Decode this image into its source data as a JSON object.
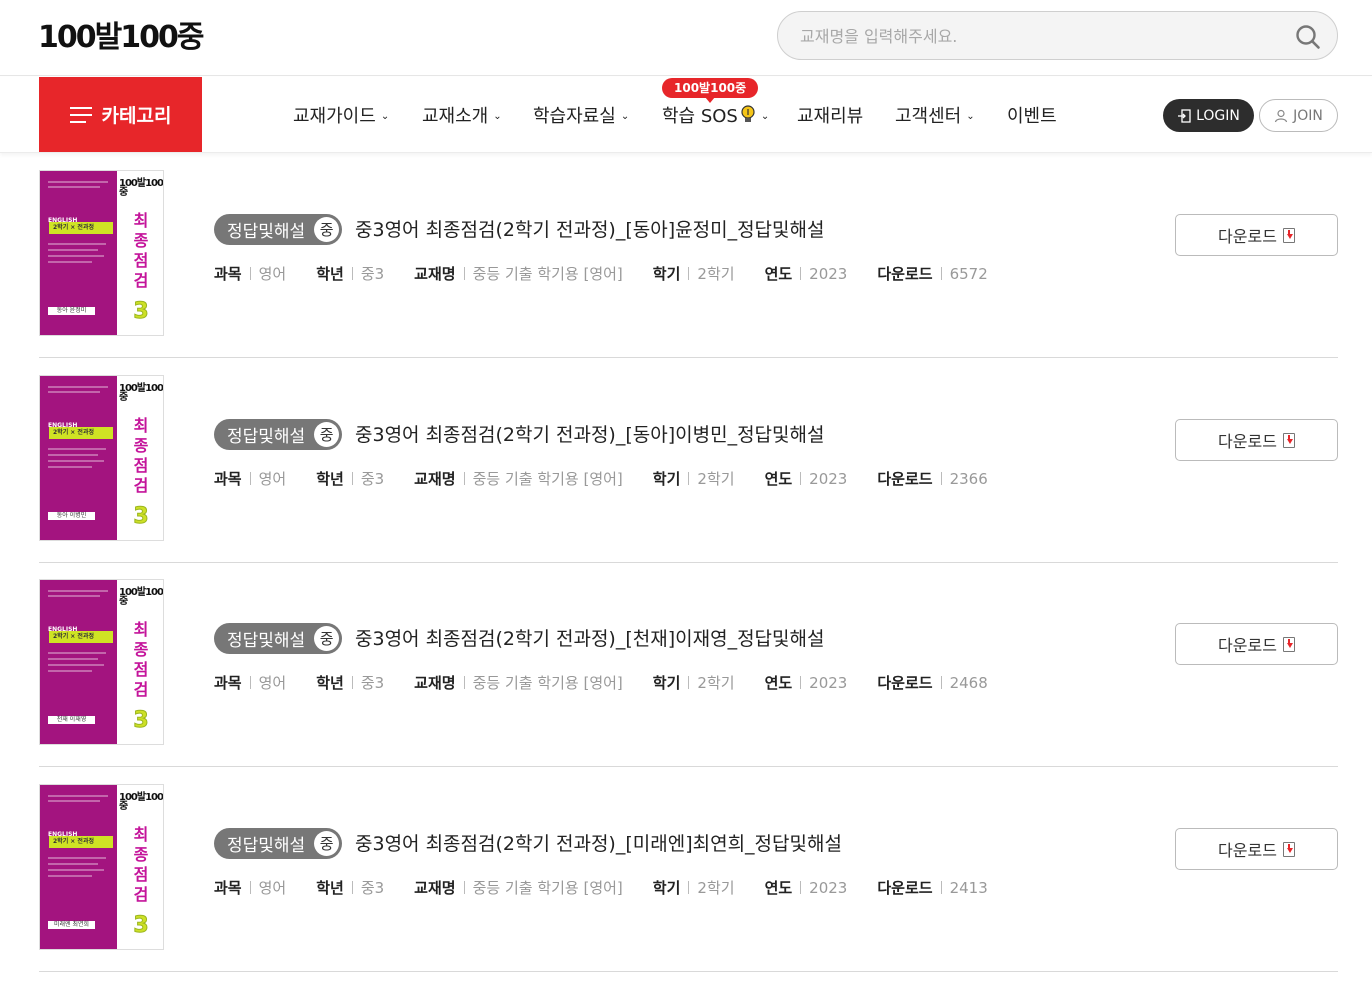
{
  "header": {
    "logo_text": "100발100중",
    "search_placeholder": "교재명을 입력해주세요."
  },
  "nav": {
    "category_label": "카테고리",
    "items": [
      {
        "label": "교재가이드",
        "chevron": "⌄"
      },
      {
        "label": "교재소개",
        "chevron": "⌄"
      },
      {
        "label": "학습자료실",
        "chevron": "⌄"
      },
      {
        "label": "학습 SOS",
        "chevron": "⌄"
      },
      {
        "label": "교재리뷰",
        "chevron": ""
      },
      {
        "label": "고객센터",
        "chevron": "⌄"
      },
      {
        "label": "이벤트",
        "chevron": ""
      }
    ],
    "sos_badge": "100발100중",
    "login_label": "LOGIN",
    "join_label": "JOIN"
  },
  "list": {
    "meta_keys": {
      "subject": "과목",
      "grade": "학년",
      "book": "교재명",
      "semester": "학기",
      "year": "연도",
      "downloads": "다운로드"
    },
    "download_label": "다운로드",
    "items": [
      {
        "badge": "정답및해설",
        "level": "중",
        "title": "중3영어 최종점검(2학기 전과정)_[동아]윤정미_정답및해설",
        "subject": "영어",
        "grade": "중3",
        "book": "중등 기출 학기용 [영어]",
        "semester": "2학기",
        "year": "2023",
        "downloads": "6572",
        "cover_publisher": "동아 윤정미"
      },
      {
        "badge": "정답및해설",
        "level": "중",
        "title": "중3영어 최종점검(2학기 전과정)_[동아]이병민_정답및해설",
        "subject": "영어",
        "grade": "중3",
        "book": "중등 기출 학기용 [영어]",
        "semester": "2학기",
        "year": "2023",
        "downloads": "2366",
        "cover_publisher": "동아 이병민"
      },
      {
        "badge": "정답및해설",
        "level": "중",
        "title": "중3영어 최종점검(2학기 전과정)_[천재]이재영_정답및해설",
        "subject": "영어",
        "grade": "중3",
        "book": "중등 기출 학기용 [영어]",
        "semester": "2학기",
        "year": "2023",
        "downloads": "2468",
        "cover_publisher": "천재 이재영"
      },
      {
        "badge": "정답및해설",
        "level": "중",
        "title": "중3영어 최종점검(2학기 전과정)_[미래엔]최연희_정답및해설",
        "subject": "영어",
        "grade": "중3",
        "book": "중등 기출 학기용 [영어]",
        "semester": "2학기",
        "year": "2023",
        "downloads": "2413",
        "cover_publisher": "미래엔 최연희"
      }
    ],
    "cover": {
      "english": "ENGLISH",
      "range": "2학기 × 전과정",
      "logo": "100발100중",
      "vertical": [
        "최",
        "종",
        "점",
        "검"
      ],
      "number": "3"
    }
  }
}
